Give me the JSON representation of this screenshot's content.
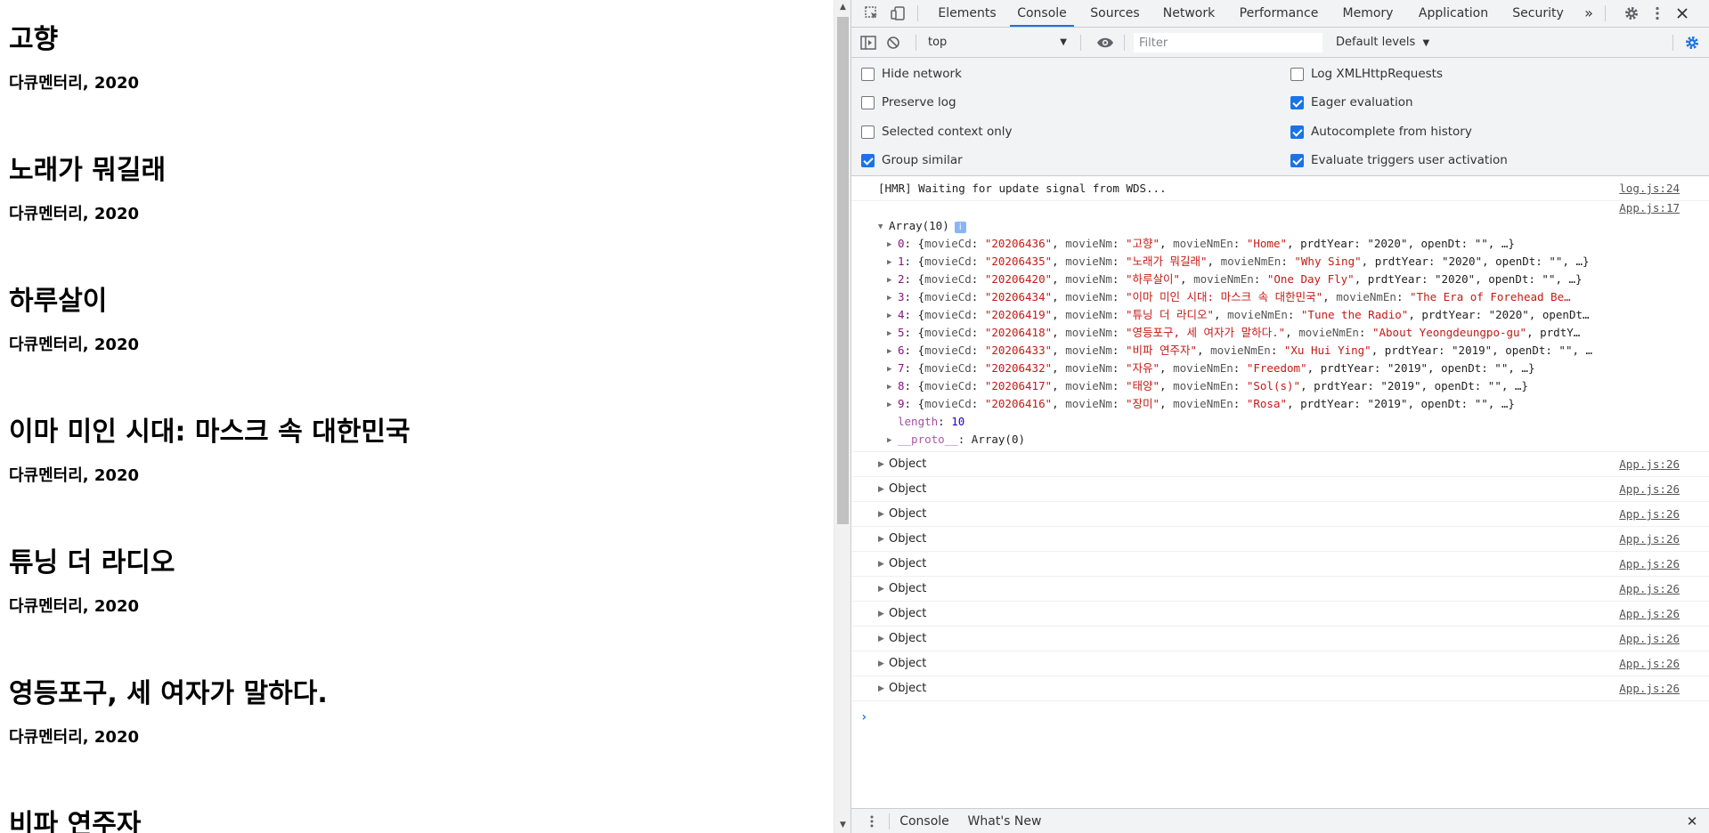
{
  "page": {
    "movies": [
      {
        "title": "고향",
        "meta": "다큐멘터리, 2020"
      },
      {
        "title": "노래가 뭐길래",
        "meta": "다큐멘터리, 2020"
      },
      {
        "title": "하루살이",
        "meta": "다큐멘터리, 2020"
      },
      {
        "title": "이마 미인 시대: 마스크 속 대한민국",
        "meta": "다큐멘터리, 2020"
      },
      {
        "title": "튜닝 더 라디오",
        "meta": "다큐멘터리, 2020"
      },
      {
        "title": "영등포구, 세 여자가 말하다.",
        "meta": "다큐멘터리, 2020"
      },
      {
        "title": "비파 연주자",
        "meta": ""
      }
    ]
  },
  "devtools": {
    "tabs": [
      "Elements",
      "Console",
      "Sources",
      "Network",
      "Performance",
      "Memory",
      "Application",
      "Security"
    ],
    "active_tab": "Console",
    "more_tabs": "»",
    "context": "top",
    "filter_placeholder": "Filter",
    "levels": "Default levels",
    "settings": {
      "left": [
        {
          "label": "Hide network",
          "checked": false
        },
        {
          "label": "Preserve log",
          "checked": false
        },
        {
          "label": "Selected context only",
          "checked": false
        },
        {
          "label": "Group similar",
          "checked": true
        }
      ],
      "right": [
        {
          "label": "Log XMLHttpRequests",
          "checked": false
        },
        {
          "label": "Eager evaluation",
          "checked": true
        },
        {
          "label": "Autocomplete from history",
          "checked": true
        },
        {
          "label": "Evaluate triggers user activation",
          "checked": true
        }
      ]
    },
    "console": {
      "hmr": {
        "text": "[HMR] Waiting for update signal from WDS...",
        "source": "log.js:24"
      },
      "array_source": "App.js:17",
      "array_label": "Array(10)",
      "array_info": "i",
      "rows": [
        {
          "idx": "0",
          "movieCd": "\"20206436\"",
          "movieNm": "\"고향\"",
          "movieNmEn": "\"Home\"",
          "tail": ", prdtYear: \"2020\", openDt: \"\", …}"
        },
        {
          "idx": "1",
          "movieCd": "\"20206435\"",
          "movieNm": "\"노래가 뭐길래\"",
          "movieNmEn": "\"Why Sing\"",
          "tail": ", prdtYear: \"2020\", openDt: \"\", …}"
        },
        {
          "idx": "2",
          "movieCd": "\"20206420\"",
          "movieNm": "\"하루살이\"",
          "movieNmEn": "\"One Day Fly\"",
          "tail": ", prdtYear: \"2020\", openDt: \"\", …}"
        },
        {
          "idx": "3",
          "movieCd": "\"20206434\"",
          "movieNm": "\"이마 미인 시대: 마스크 속 대한민국\"",
          "movieNmEn": "\"The Era of Forehead Be…",
          "tail": ""
        },
        {
          "idx": "4",
          "movieCd": "\"20206419\"",
          "movieNm": "\"튜닝 더 라디오\"",
          "movieNmEn": "\"Tune the Radio\"",
          "tail": ", prdtYear: \"2020\", openDt…"
        },
        {
          "idx": "5",
          "movieCd": "\"20206418\"",
          "movieNm": "\"영등포구, 세 여자가 말하다.\"",
          "movieNmEn": "\"About Yeongdeungpo-gu\"",
          "tail": ", prdtY…"
        },
        {
          "idx": "6",
          "movieCd": "\"20206433\"",
          "movieNm": "\"비파 연주자\"",
          "movieNmEn": "\"Xu Hui Ying\"",
          "tail": ", prdtYear: \"2019\", openDt: \"\", …"
        },
        {
          "idx": "7",
          "movieCd": "\"20206432\"",
          "movieNm": "\"자유\"",
          "movieNmEn": "\"Freedom\"",
          "tail": ", prdtYear: \"2019\", openDt: \"\", …}"
        },
        {
          "idx": "8",
          "movieCd": "\"20206417\"",
          "movieNm": "\"태양\"",
          "movieNmEn": "\"Sol(s)\"",
          "tail": ", prdtYear: \"2019\", openDt: \"\", …}"
        },
        {
          "idx": "9",
          "movieCd": "\"20206416\"",
          "movieNm": "\"장미\"",
          "movieNmEn": "\"Rosa\"",
          "tail": ", prdtYear: \"2019\", openDt: \"\", …}"
        }
      ],
      "length_label": "length",
      "length_value": "10",
      "proto_label": "__proto__",
      "proto_value": "Array(0)",
      "objects": [
        {
          "label": "Object",
          "source": "App.js:26"
        },
        {
          "label": "Object",
          "source": "App.js:26"
        },
        {
          "label": "Object",
          "source": "App.js:26"
        },
        {
          "label": "Object",
          "source": "App.js:26"
        },
        {
          "label": "Object",
          "source": "App.js:26"
        },
        {
          "label": "Object",
          "source": "App.js:26"
        },
        {
          "label": "Object",
          "source": "App.js:26"
        },
        {
          "label": "Object",
          "source": "App.js:26"
        },
        {
          "label": "Object",
          "source": "App.js:26"
        },
        {
          "label": "Object",
          "source": "App.js:26"
        }
      ],
      "prompt": "›"
    },
    "drawer": {
      "tabs": [
        "Console",
        "What's New"
      ],
      "close": "✕"
    }
  }
}
